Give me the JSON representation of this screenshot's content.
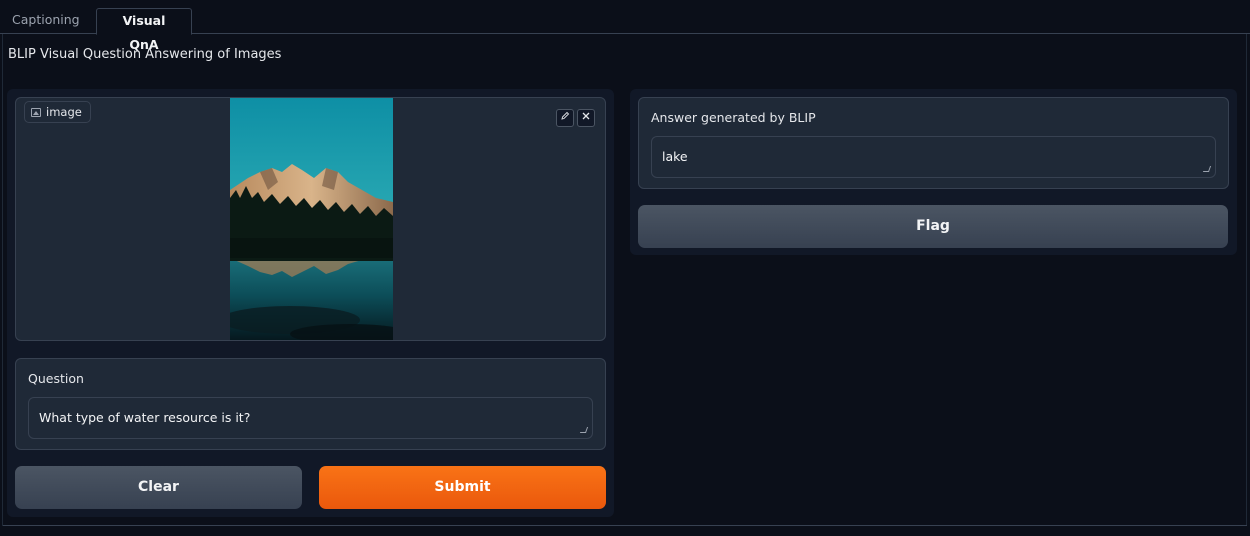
{
  "tabs": [
    {
      "label": "Captioning",
      "active": false
    },
    {
      "label": "Visual QnA",
      "active": true
    }
  ],
  "description": "BLIP Visual Question Answering of Images",
  "image_input": {
    "label": "image",
    "edit_icon": "pencil-icon",
    "clear_icon": "close-icon"
  },
  "question": {
    "label": "Question",
    "value": "What type of water resource is it?"
  },
  "buttons": {
    "clear": "Clear",
    "submit": "Submit",
    "flag": "Flag"
  },
  "answer": {
    "label": "Answer generated by BLIP",
    "value": "lake"
  },
  "colors": {
    "background": "#0b0f19",
    "panel": "#111827",
    "block": "#1f2937",
    "border": "#374151",
    "primary": "#f97316",
    "secondary": "#4b5563"
  }
}
